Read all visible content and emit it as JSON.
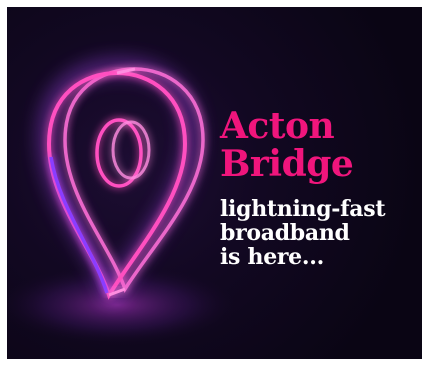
{
  "banner": {
    "headline_lines": [
      "Acton",
      "Bridge"
    ],
    "tagline_lines": [
      "lightning-fast",
      "broadband",
      "is here..."
    ],
    "pin_icon": "location-pin-icon"
  },
  "colors": {
    "headline": "#f0157c",
    "tagline": "#ffffff",
    "background": "#120822",
    "neon_pink": "#ff4fc0",
    "neon_violet": "#8a3dff"
  }
}
